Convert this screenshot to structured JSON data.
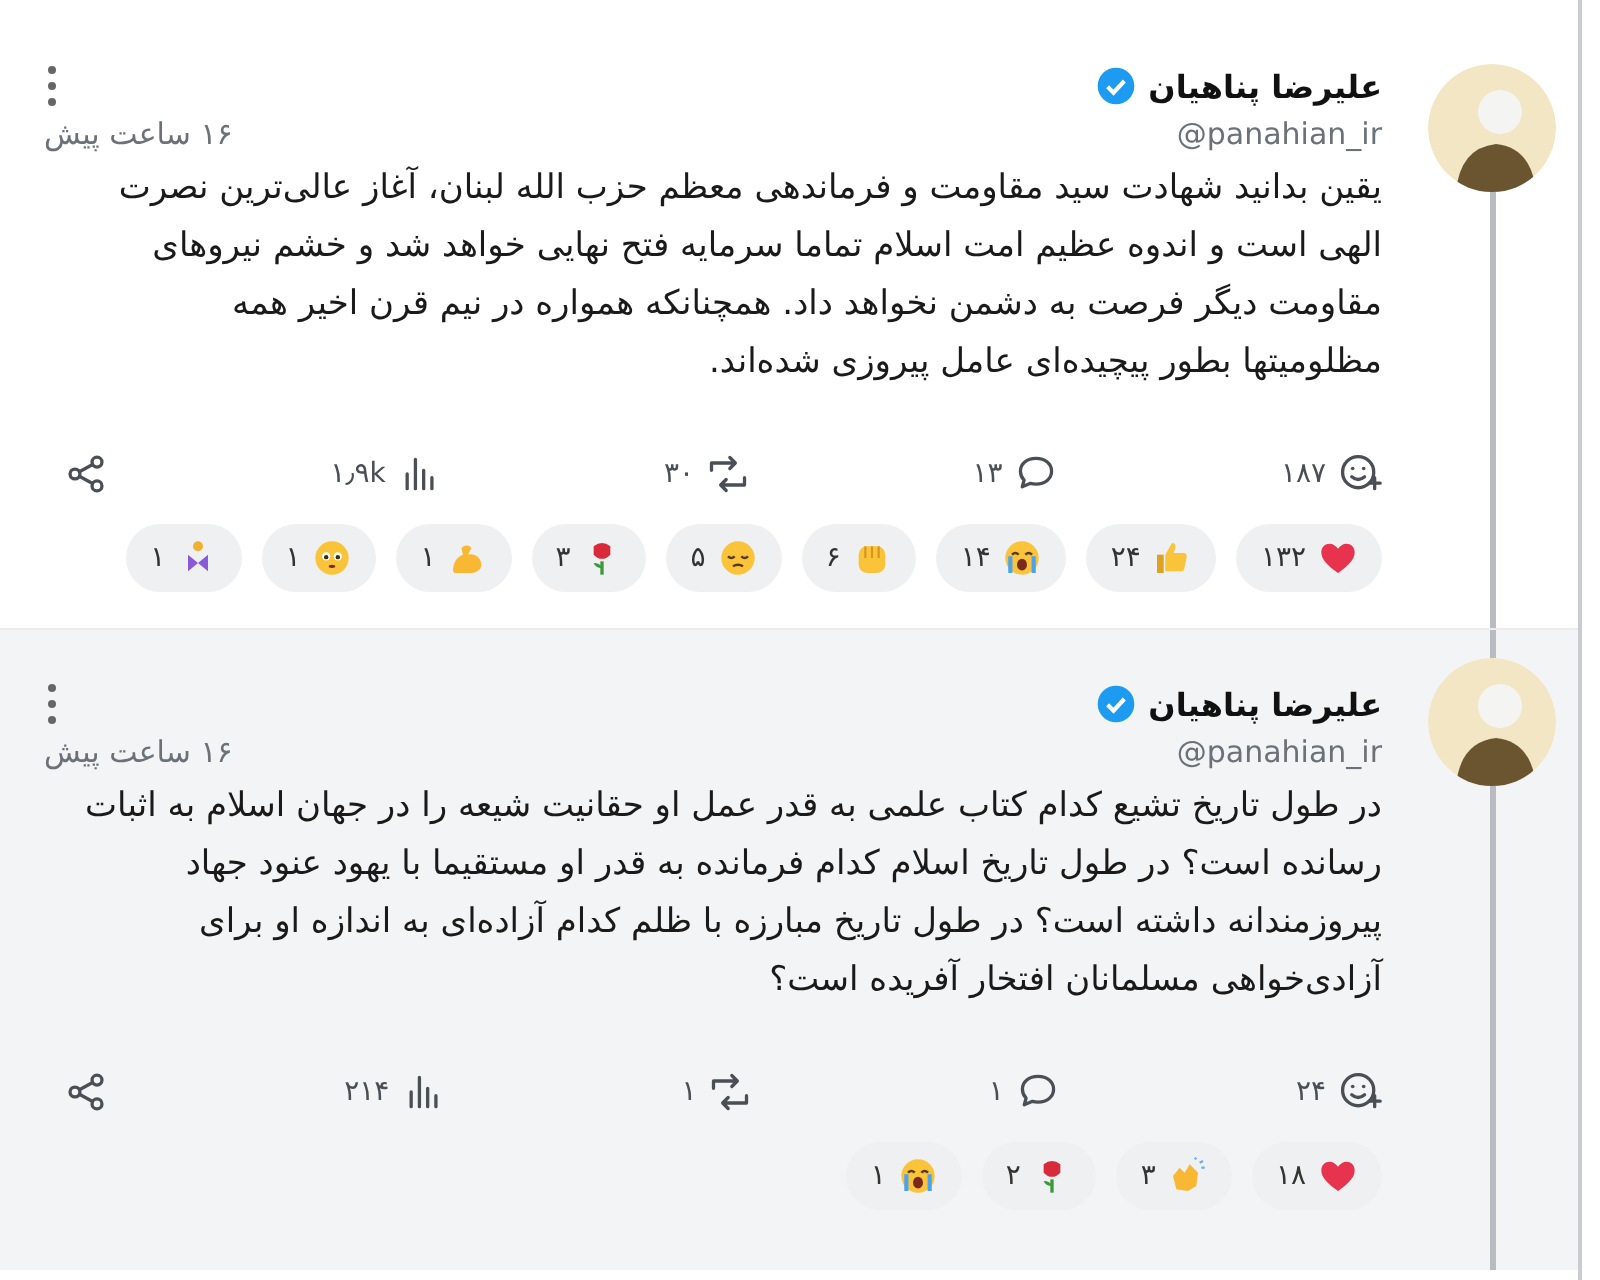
{
  "posts": [
    {
      "author": "علیرضا پناهیان",
      "verified": true,
      "handle": "@panahian_ir",
      "time": "۱۶ ساعت پیش",
      "highlighted": false,
      "text": "یقین بدانید شهادت سید مقاومت و فرماندهی معظم حزب الله لبنان، آغاز عالی‌ترین نصرت الهی است و اندوه عظیم امت اسلام تماما سرمایه فتح نهایی خواهد شد و خشم نیروهای مقاومت دیگر فرصت به دشمن نخواهد داد. همچنانکه همواره در نیم قرن اخیر همه مظلومیتها بطور پیچیده‌ای عامل پیروزی شده‌اند.",
      "actions": [
        {
          "kind": "react",
          "count": "۱۸۷"
        },
        {
          "kind": "reply",
          "count": "۱۳"
        },
        {
          "kind": "repost",
          "count": "۳۰"
        },
        {
          "kind": "views",
          "count": "۱٫۹k"
        },
        {
          "kind": "share"
        }
      ],
      "reactions": [
        {
          "kind": "heart",
          "count": "۱۳۲"
        },
        {
          "kind": "thumbs",
          "count": "۲۴"
        },
        {
          "kind": "crying",
          "count": "۱۴"
        },
        {
          "kind": "fist",
          "count": "۶"
        },
        {
          "kind": "sad",
          "count": "۵"
        },
        {
          "kind": "rose",
          "count": "۳"
        },
        {
          "kind": "muscle",
          "count": "۱"
        },
        {
          "kind": "worried",
          "count": "۱"
        },
        {
          "kind": "figure",
          "count": "۱"
        }
      ]
    },
    {
      "author": "علیرضا پناهیان",
      "verified": true,
      "handle": "@panahian_ir",
      "time": "۱۶ ساعت پیش",
      "highlighted": true,
      "text": "در طول تاریخ تشیع کدام کتاب علمی به قدر عمل او حقانیت شیعه را در جهان اسلام به اثبات رسانده است؟ در طول تاریخ اسلام کدام فرمانده به قدر او مستقیما با یهود عنود جهاد پیروزمندانه داشته است؟ در طول تاریخ مبارزه با ظلم کدام آزاده‌ای به اندازه او برای آزادی‌خواهی مسلمانان افتخار آفریده است؟",
      "actions": [
        {
          "kind": "react",
          "count": "۲۴"
        },
        {
          "kind": "reply",
          "count": "۱"
        },
        {
          "kind": "repost",
          "count": "۱"
        },
        {
          "kind": "views",
          "count": "۲۱۴"
        },
        {
          "kind": "share"
        }
      ],
      "reactions": [
        {
          "kind": "heart",
          "count": "۱۸"
        },
        {
          "kind": "clap",
          "count": "۳"
        },
        {
          "kind": "rose",
          "count": "۲"
        },
        {
          "kind": "crying",
          "count": "۱"
        }
      ]
    }
  ]
}
